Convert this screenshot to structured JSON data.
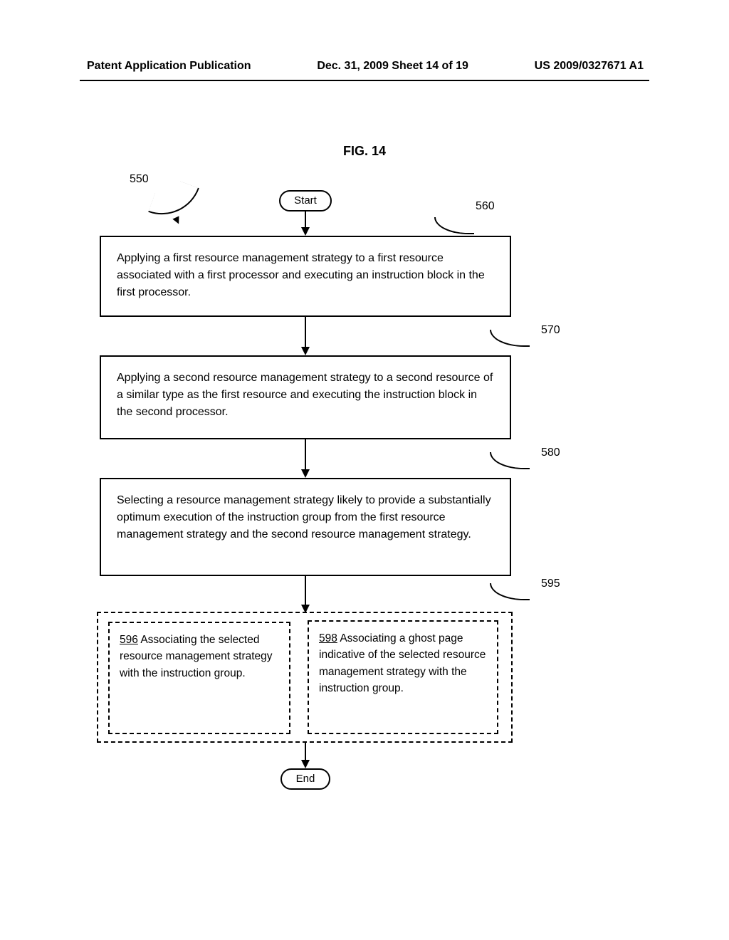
{
  "header": {
    "left": "Patent Application Publication",
    "center": "Dec. 31, 2009  Sheet 14 of 19",
    "right": "US 2009/0327671 A1"
  },
  "figure_title": "FIG. 14",
  "labels": {
    "ref550": "550",
    "ref560": "560",
    "ref570": "570",
    "ref580": "580",
    "ref595": "595",
    "ref596": "596",
    "ref598": "598"
  },
  "terminals": {
    "start": "Start",
    "end": "End"
  },
  "boxes": {
    "b560": "Applying a first resource management strategy to a first resource associated with a first processor and executing an instruction block in the first processor.",
    "b570": "Applying a second resource management strategy to a second resource of a similar type as the first resource and executing the instruction block in the second processor.",
    "b580": "Selecting a resource management strategy likely to provide a substantially optimum execution of the instruction group from the first resource management strategy and the second resource management strategy.",
    "b596": "  Associating the selected resource management strategy with the instruction group.",
    "b598": "  Associating a ghost page indicative of the selected resource management strategy with the instruction group."
  },
  "chart_data": {
    "type": "flowchart",
    "title": "FIG. 14",
    "nodes": [
      {
        "id": "start",
        "shape": "terminal",
        "label": "Start"
      },
      {
        "id": "560",
        "shape": "process",
        "label": "Applying a first resource management strategy to a first resource associated with a first processor and executing an instruction block in the first processor."
      },
      {
        "id": "570",
        "shape": "process",
        "label": "Applying a second resource management strategy to a second resource of a similar type as the first resource and executing the instruction block in the second processor."
      },
      {
        "id": "580",
        "shape": "process",
        "label": "Selecting a resource management strategy likely to provide a substantially optimum execution of the instruction group from the first resource management strategy and the second resource management strategy."
      },
      {
        "id": "595",
        "shape": "optional-group",
        "children": [
          "596",
          "598"
        ]
      },
      {
        "id": "596",
        "shape": "optional",
        "label": "Associating the selected resource management strategy with the instruction group."
      },
      {
        "id": "598",
        "shape": "optional",
        "label": "Associating a ghost page indicative of the selected resource management strategy with the instruction group."
      },
      {
        "id": "end",
        "shape": "terminal",
        "label": "End"
      }
    ],
    "edges": [
      {
        "from": "start",
        "to": "560"
      },
      {
        "from": "560",
        "to": "570"
      },
      {
        "from": "570",
        "to": "580"
      },
      {
        "from": "580",
        "to": "595"
      },
      {
        "from": "595",
        "to": "end"
      }
    ],
    "overall_ref": "550"
  }
}
